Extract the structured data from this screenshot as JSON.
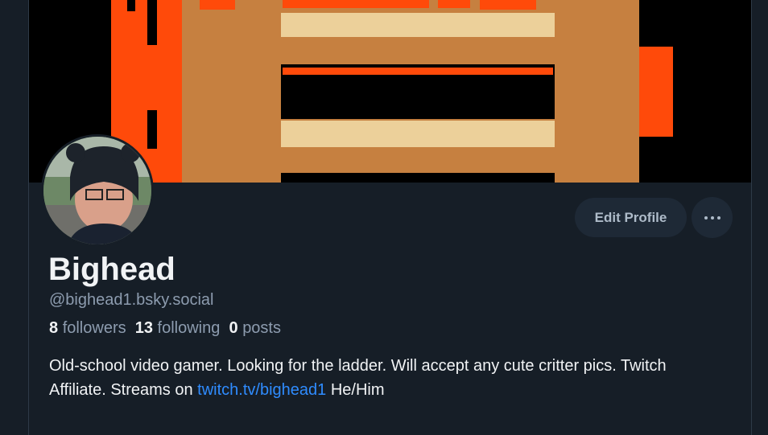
{
  "profile": {
    "display_name": "Bighead",
    "handle": "@bighead1.bsky.social",
    "followers_count": "8",
    "followers_label": "followers",
    "following_count": "13",
    "following_label": "following",
    "posts_count": "0",
    "posts_label": "posts",
    "bio_text": "Old-school video gamer. Looking for the ladder.  Will accept any cute critter pics.  Twitch Affiliate. Streams on",
    "bio_link": "twitch.tv/bighead1",
    "bio_suffix": "He/Him"
  },
  "actions": {
    "edit_label": "Edit Profile",
    "more_icon": "ellipsis-icon"
  },
  "colors": {
    "background": "#161e27",
    "button_bg": "#1e2936",
    "link": "#2f8cff",
    "banner_orange": "#ff4a0a",
    "banner_tan": "#c68040"
  }
}
